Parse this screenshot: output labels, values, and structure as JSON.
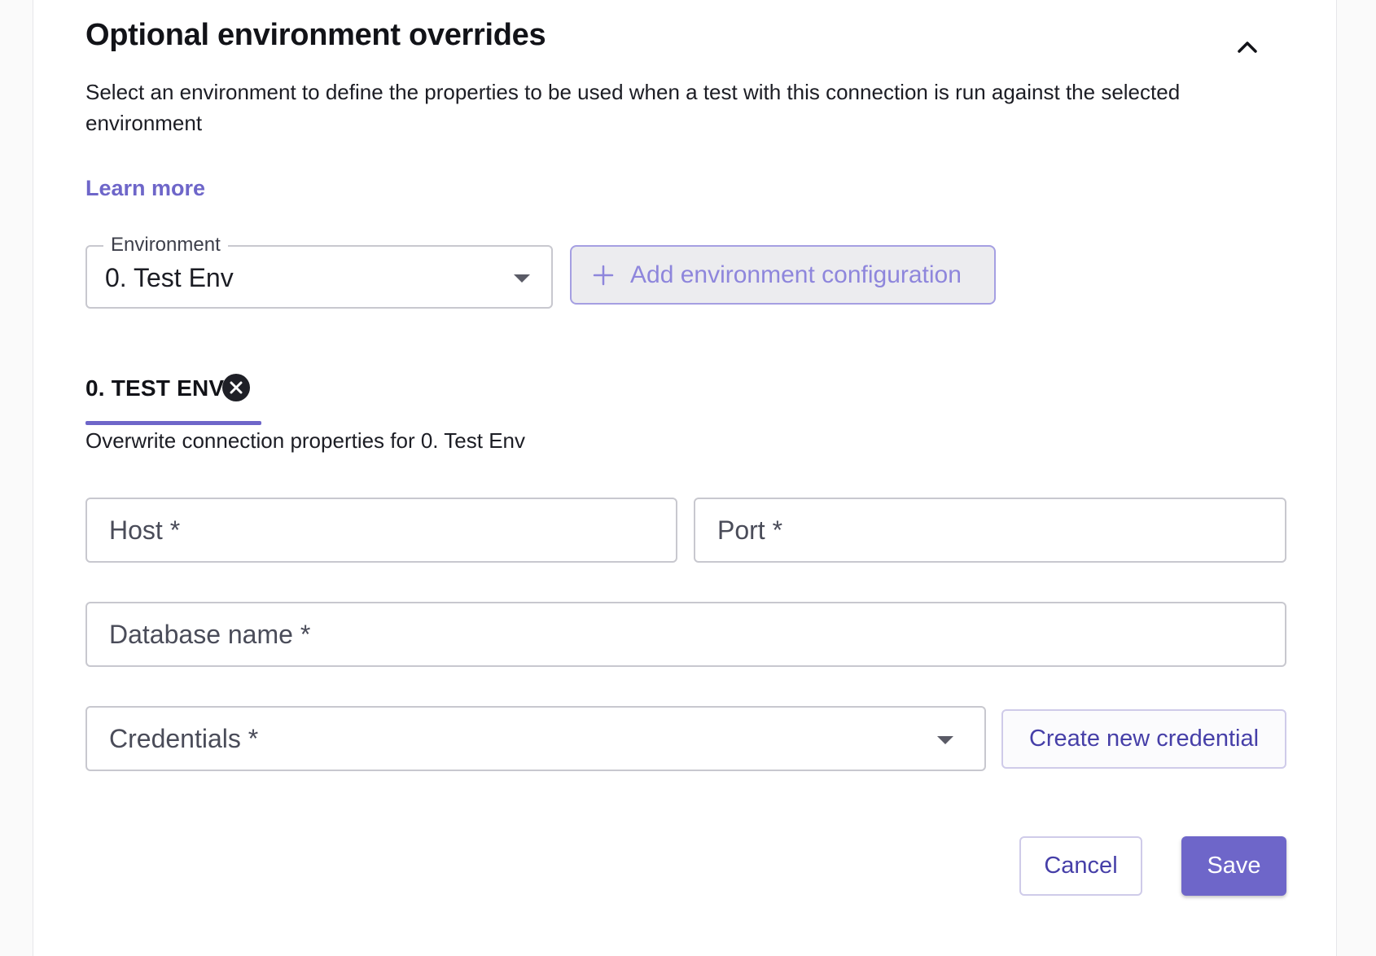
{
  "section": {
    "title": "Optional environment overrides",
    "description": "Select an environment to define the properties to be used when a test with this connection is run against the selected environment",
    "learn_more": "Learn more"
  },
  "environment_select": {
    "label": "Environment",
    "value": "0. Test Env"
  },
  "add_env_button": {
    "icon": "plus-icon",
    "label": "Add environment configuration"
  },
  "tab": {
    "label": "0. TEST ENV",
    "close_icon": "close-circle-icon"
  },
  "overwrite_text": "Overwrite connection properties for 0. Test Env",
  "fields": {
    "host": "Host *",
    "port": "Port *",
    "database": "Database name *",
    "credentials": "Credentials *"
  },
  "buttons": {
    "create_credential": "Create new credential",
    "cancel": "Cancel",
    "save": "Save"
  },
  "colors": {
    "accent": "#6e66c9",
    "accent_text": "#463fa8",
    "border": "#c8c8cf"
  }
}
